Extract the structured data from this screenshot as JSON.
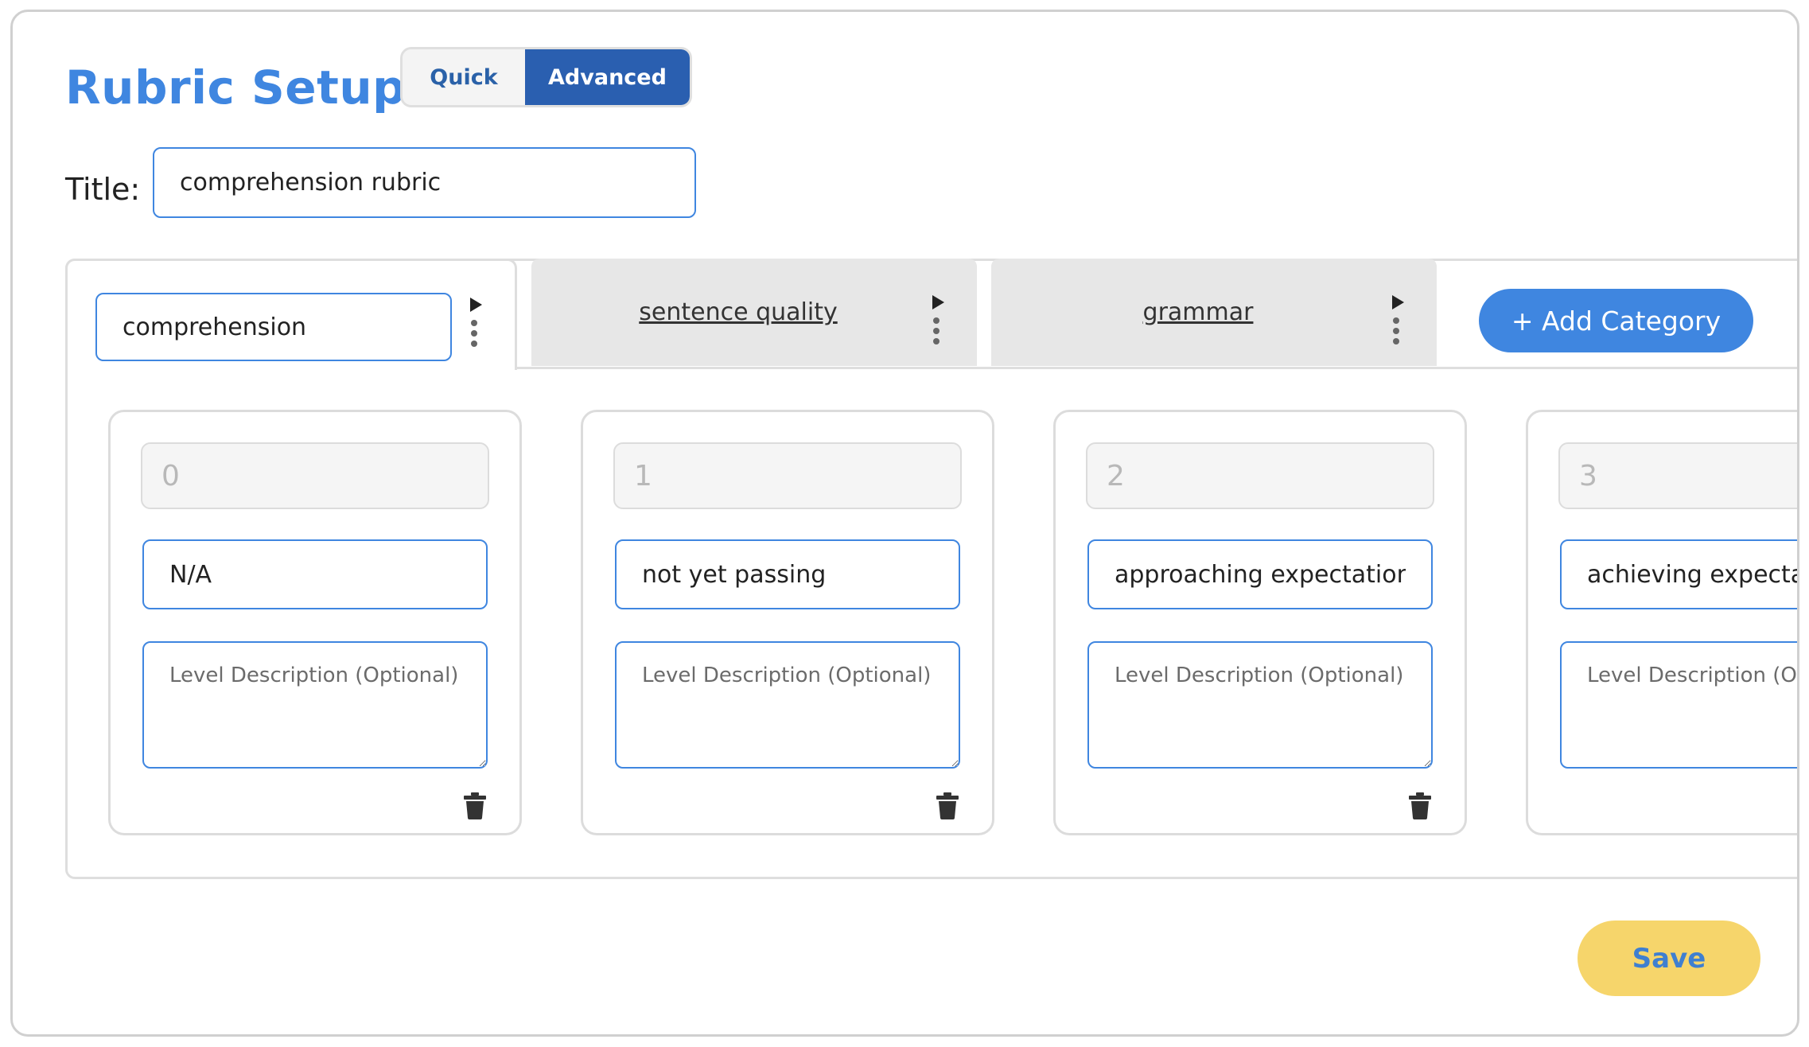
{
  "header": {
    "title": "Rubric Setup",
    "mode_options": [
      "Quick",
      "Advanced"
    ],
    "selected_mode": "Advanced"
  },
  "title_field": {
    "label": "Title:",
    "value": "comprehension rubric"
  },
  "categories": [
    {
      "name": "comprehension",
      "active": true
    },
    {
      "name": "sentence quality",
      "active": false
    },
    {
      "name": "grammar",
      "active": false
    }
  ],
  "add_category_label": "+ Add Category",
  "levels": [
    {
      "score_placeholder": "0",
      "label": "N/A",
      "description_placeholder": "Level Description (Optional)"
    },
    {
      "score_placeholder": "1",
      "label": "not yet passing",
      "description_placeholder": "Level Description (Optional)"
    },
    {
      "score_placeholder": "2",
      "label": "approaching expectations",
      "description_placeholder": "Level Description (Optional)"
    },
    {
      "score_placeholder": "3",
      "label": "achieving expectations",
      "description_placeholder": "Level Description (Optional)"
    }
  ],
  "save_label": "Save",
  "colors": {
    "accent": "#3f86e0",
    "selected_toggle": "#2a5fb0",
    "save_button": "#f6d56b",
    "inactive_tab": "#e7e7e7"
  },
  "icons": {
    "tab_expand": "play-icon",
    "tab_menu": "kebab-icon",
    "level_delete": "trash-icon"
  }
}
